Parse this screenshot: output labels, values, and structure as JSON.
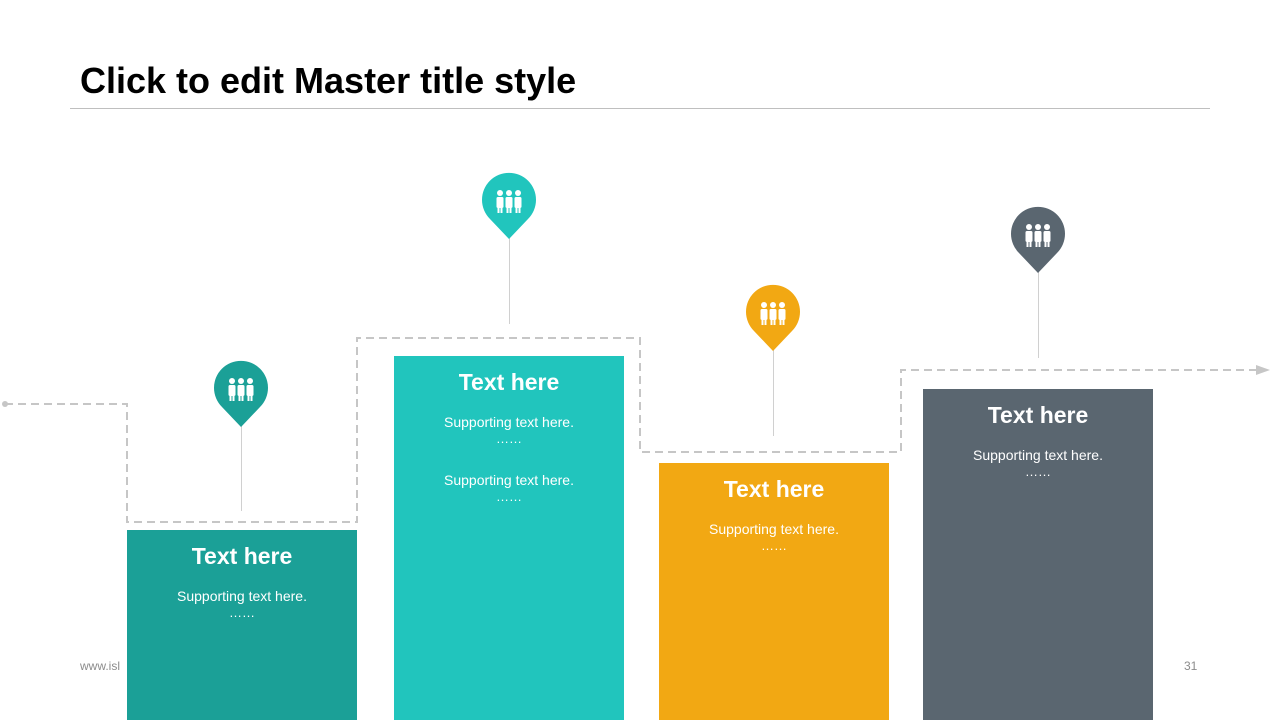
{
  "slide": {
    "title": "Click to edit Master title style",
    "footer_url": "www.isl",
    "page_number": "31"
  },
  "colors": {
    "teal_dark": "#1ba097",
    "teal_light": "#21c5bd",
    "orange": "#f2a813",
    "slate": "#5a6670",
    "connector": "#c6c6c6"
  },
  "steps": [
    {
      "title": "Text here",
      "lines": [
        "Supporting text here.",
        "……"
      ],
      "icon": "people-group-icon"
    },
    {
      "title": "Text here",
      "lines": [
        "Supporting text here.",
        "……",
        "Supporting text here.",
        "……"
      ],
      "icon": "people-group-icon"
    },
    {
      "title": "Text here",
      "lines": [
        "Supporting text here.",
        "……"
      ],
      "icon": "people-group-icon"
    },
    {
      "title": "Text here",
      "lines": [
        "Supporting text here.",
        "……"
      ],
      "icon": "people-group-icon"
    }
  ]
}
